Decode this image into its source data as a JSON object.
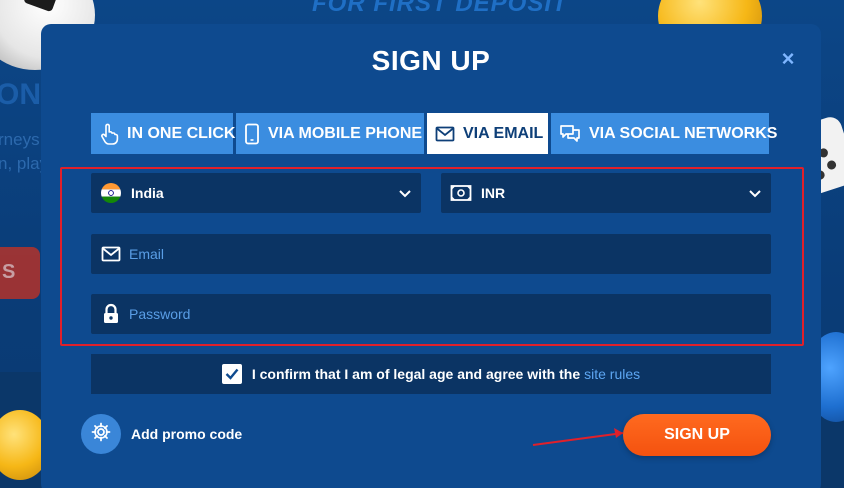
{
  "background": {
    "banner_text": "FOR FIRST DEPOSIT",
    "money_text": "ONEY",
    "line1": "rneys and",
    "line2": "n, play",
    "red_button_text": "S"
  },
  "modal": {
    "title": "SIGN UP",
    "close_icon": "×"
  },
  "tabs": [
    {
      "label": "IN ONE CLICK",
      "icon": "hand-pointer-icon",
      "active": false
    },
    {
      "label": "VIA MOBILE PHONE",
      "icon": "phone-icon",
      "active": false
    },
    {
      "label": "VIA EMAIL",
      "icon": "envelope-icon",
      "active": true
    },
    {
      "label": "VIA SOCIAL NETWORKS",
      "icon": "chat-icon",
      "active": false
    }
  ],
  "form": {
    "country": {
      "value": "India",
      "icon": "india-flag-icon"
    },
    "currency": {
      "value": "INR",
      "icon": "banknote-icon"
    },
    "email": {
      "placeholder": "Email",
      "value": ""
    },
    "password": {
      "placeholder": "Password",
      "value": ""
    },
    "agree": {
      "checked": true,
      "text": "I confirm that I am of legal age and agree with the",
      "link": "site rules"
    },
    "promo_label": "Add promo code",
    "submit_label": "SIGN UP"
  },
  "colors": {
    "modal_bg": "#0e4a8f",
    "tab_bg": "#3b8de0",
    "tab_active_bg": "#ffffff",
    "field_bg": "#0b3464",
    "accent_orange": "#f4520f",
    "link_blue": "#5da6f2",
    "highlight_red": "#e0202a"
  }
}
